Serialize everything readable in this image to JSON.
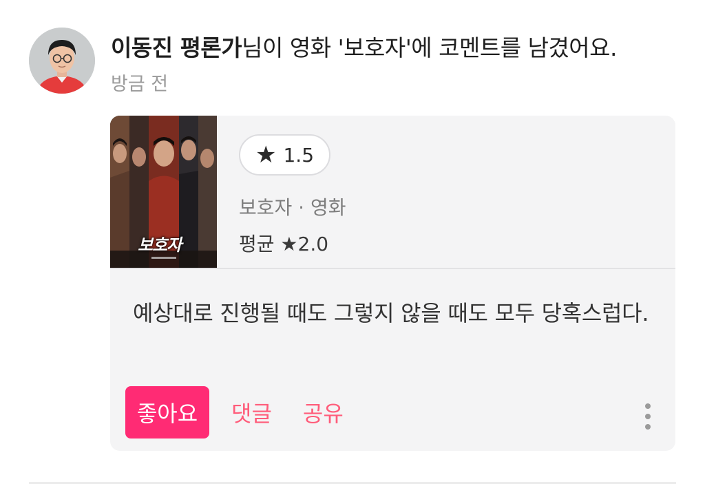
{
  "feed_item": {
    "author_name": "이동진 평론가",
    "action_text": "님이 영화 '보호자'에 코멘트를 남겼어요.",
    "timestamp": "방금 전"
  },
  "movie_card": {
    "poster_title": "보호자",
    "user_rating": "1.5",
    "star_glyph": "★",
    "title_and_type": "보호자 · 영화",
    "average_label": "평균 ★2.0"
  },
  "comment": {
    "text": "예상대로 진행될 때도 그렇지 않을 때도 모두 당혹스럽다."
  },
  "actions": {
    "like_label": "좋아요",
    "reply_label": "댓글",
    "share_label": "공유"
  },
  "colors": {
    "like_bg": "#ff2b74",
    "action_text": "#ff5c7a",
    "card_bg": "#f4f4f5"
  },
  "icons": {
    "more": "vertical-ellipsis-icon",
    "star": "star-icon",
    "avatar": "profile-photo"
  }
}
